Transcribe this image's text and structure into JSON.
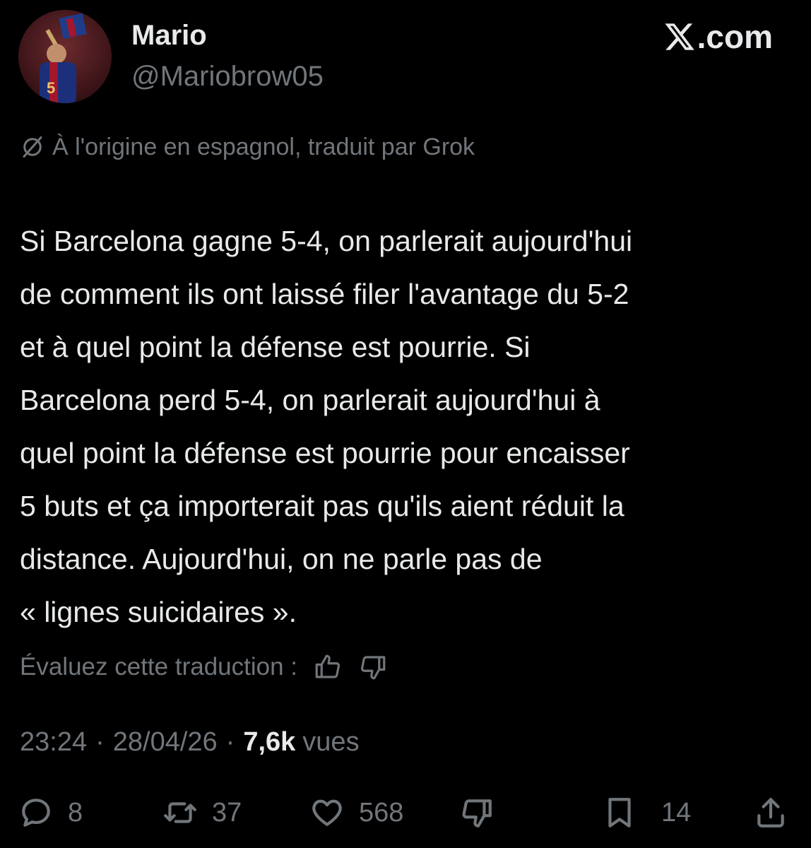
{
  "tweet": {
    "display_name": "Mario",
    "handle": "@Mariobrow05",
    "brand": ".com",
    "translation_note": "À l'origine en espagnol, traduit par Grok",
    "text": "Si Barcelona gagne 5-4, on parlerait aujourd'hui\nde comment ils ont laissé filer l'avantage du 5-2\net à quel point la défense est pourrie. Si\nBarcelona perd 5-4, on parlerait aujourd'hui à\nquel point la défense est pourrie pour encaisser\n5 buts et ça importerait pas qu'ils aient réduit la\ndistance. Aujourd'hui, on ne parle pas de\n« lignes suicidaires ».",
    "rate_label": "Évaluez cette traduction :",
    "time": "23:24",
    "date": "28/04/26",
    "views_count": "7,6k",
    "views_label": "vues",
    "separator": "·"
  },
  "actions": {
    "replies": "8",
    "reposts": "37",
    "likes": "568",
    "bookmarks": "14"
  },
  "icons": {
    "translation": "globe-slash-icon",
    "rate_up": "thumbs-up-icon",
    "rate_down": "thumbs-down-icon",
    "reply": "reply-icon",
    "repost": "repost-icon",
    "like": "heart-icon",
    "dislike": "thumbs-down-icon",
    "bookmark": "bookmark-icon",
    "share": "share-icon"
  },
  "colors": {
    "background": "#000000",
    "primary_text": "#e7e9ea",
    "secondary_text": "#71767b"
  }
}
